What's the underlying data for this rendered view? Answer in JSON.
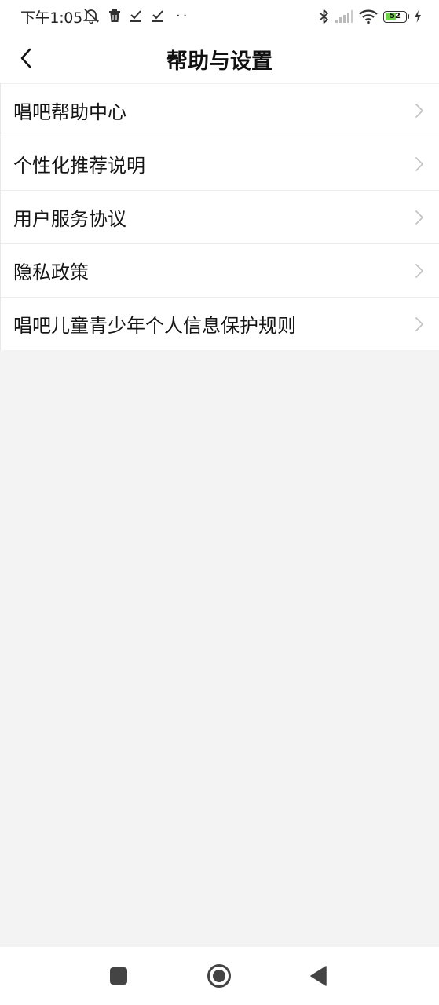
{
  "status_bar": {
    "time": "下午1:05",
    "left_icons": [
      "alarm-off-icon",
      "trash-icon",
      "download-done-icon",
      "download-done-icon"
    ],
    "more_dots": "··",
    "battery_percent": 52,
    "battery_label": "52",
    "battery_color": "#6ed246",
    "right_icons": [
      "bluetooth-icon",
      "signal-icon",
      "wifi-icon",
      "battery-icon",
      "charging-icon"
    ]
  },
  "header": {
    "title": "帮助与设置",
    "back_icon": "chevron-left-icon"
  },
  "menu": {
    "items": [
      {
        "label": "唱吧帮助中心"
      },
      {
        "label": "个性化推荐说明"
      },
      {
        "label": "用户服务协议"
      },
      {
        "label": "隐私政策"
      },
      {
        "label": "唱吧儿童青少年个人信息保护规则"
      }
    ]
  },
  "nav_bar": {
    "icons": [
      "recent-apps-icon",
      "home-icon",
      "back-triangle-icon"
    ]
  },
  "colors": {
    "background": "#f3f3f3",
    "surface": "#ffffff",
    "chevron": "#c4c4c4"
  }
}
